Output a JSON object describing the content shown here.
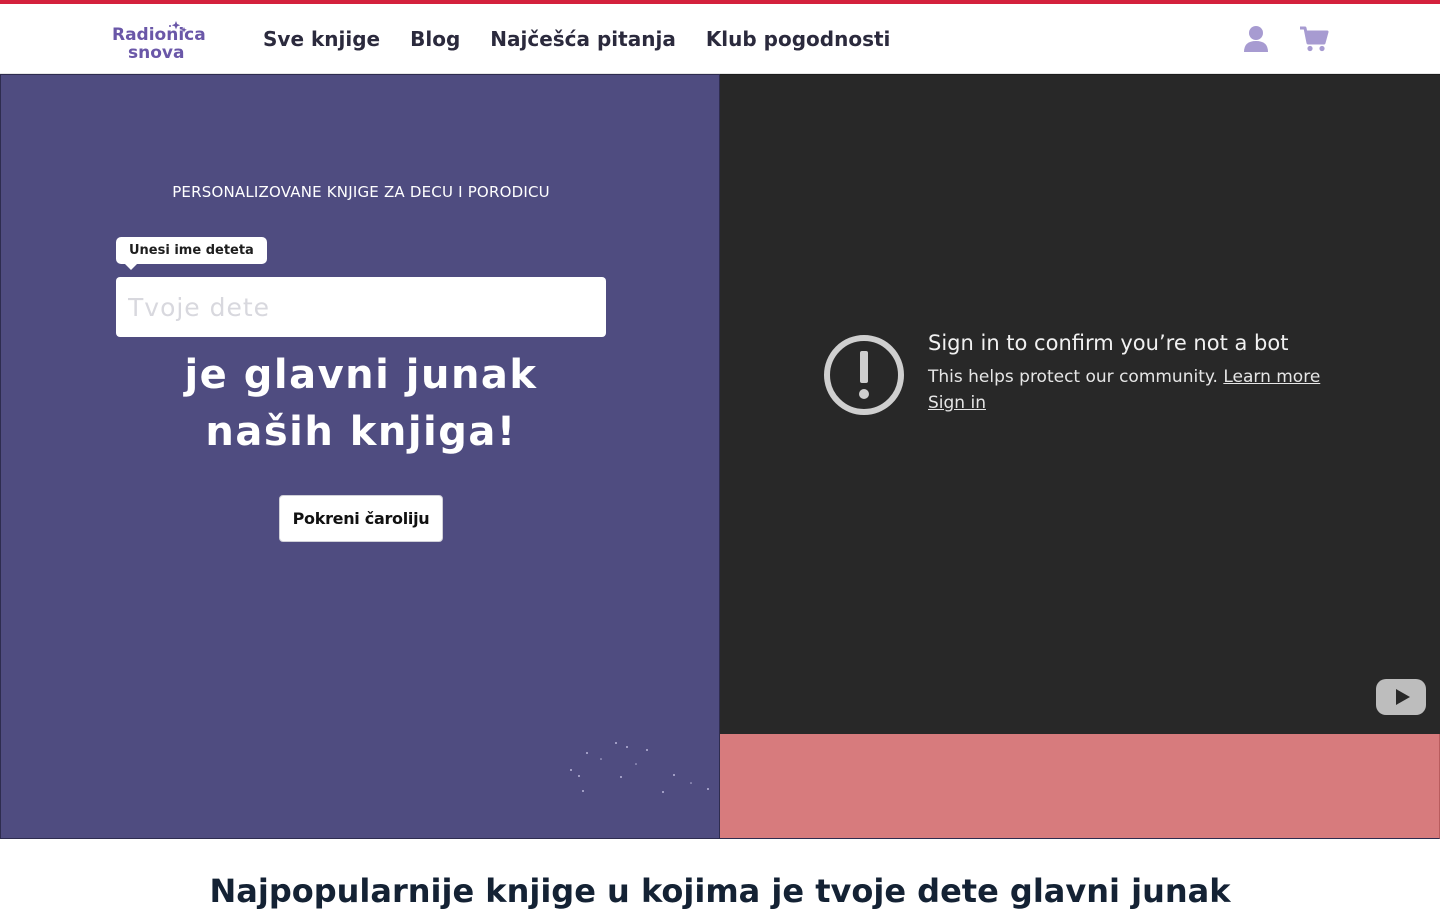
{
  "colors": {
    "accent_top_line": "#d4213d",
    "hero_left_bg": "#4f4c80",
    "hero_right_bottom_bg": "#d77b7d",
    "video_bg": "#282828",
    "brand_purple": "#6a57a8",
    "header_icon": "#a79bd1"
  },
  "header": {
    "logo_text_line1": "Radionica",
    "logo_text_line2": "snova",
    "nav": [
      {
        "label": "Sve knjige"
      },
      {
        "label": "Blog"
      },
      {
        "label": "Najčešća pitanja"
      },
      {
        "label": "Klub pogodnosti"
      }
    ],
    "icons": [
      "user-icon",
      "cart-icon"
    ]
  },
  "hero": {
    "tagline": "PERSONALIZOVANE KNJIGE ZA DECU I PORODICU",
    "tooltip": "Unesi ime deteta",
    "input_placeholder": "Tvoje dete",
    "input_value": "",
    "headline_line1": "je glavni junak",
    "headline_line2": "naših knjiga!",
    "cta_label": "Pokreni čaroliju"
  },
  "video": {
    "title": "Sign in to confirm you’re not a bot",
    "subtitle": "This helps protect our community.",
    "learn_more": "Learn more",
    "sign_in": "Sign in",
    "icons": [
      "warning-icon",
      "youtube-logo-icon"
    ]
  },
  "section": {
    "title": "Najpopularnije knjige u kojima je tvoje dete glavni junak"
  }
}
